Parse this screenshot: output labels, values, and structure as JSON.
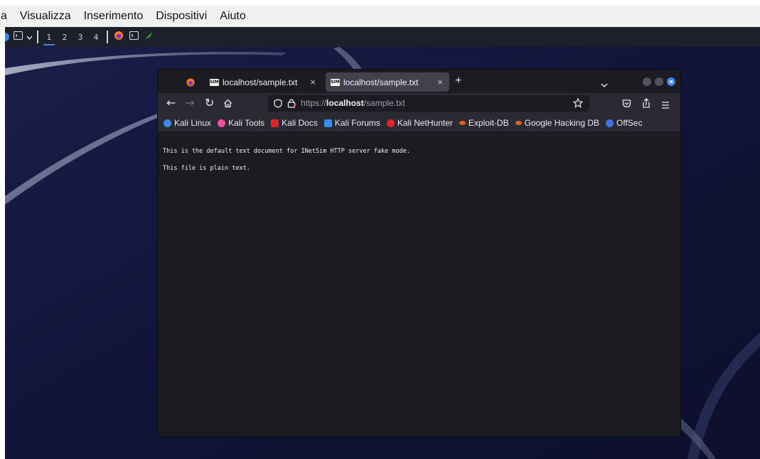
{
  "vm_menubar": {
    "items": [
      "a",
      "Visualizza",
      "Inserimento",
      "Dispositivi",
      "Aiuto"
    ]
  },
  "panel": {
    "workspaces": [
      "1",
      "2",
      "3",
      "4"
    ],
    "active_workspace": "1",
    "icons": [
      "kali-menu-icon",
      "terminal-icon",
      "chevron-down-icon",
      "firefox-icon",
      "terminal-icon",
      "kali-dragon-icon"
    ]
  },
  "browser": {
    "tabs": [
      {
        "title": "localhost/sample.txt",
        "favicon": "SIM"
      },
      {
        "title": "localhost/sample.txt",
        "favicon": "SIM"
      }
    ],
    "new_tab": "+",
    "tab_close": "×",
    "url": {
      "scheme": "https://",
      "host": "localhost",
      "path": "/sample.txt"
    },
    "toolbar_icons": [
      "back-icon",
      "forward-icon",
      "reload-icon",
      "home-icon",
      "tracking-shield-icon",
      "lock-icon",
      "bookmark-star-icon",
      "pocket-icon",
      "extensions-icon",
      "menu-icon"
    ],
    "bookmarks": [
      {
        "label": "Kali Linux",
        "color": "#3b8beb"
      },
      {
        "label": "Kali Tools",
        "color": "#ff4fa3"
      },
      {
        "label": "Kali Docs",
        "color": "#e0262d"
      },
      {
        "label": "Kali Forums",
        "color": "#3b8beb"
      },
      {
        "label": "Kali NetHunter",
        "color": "#e0262d"
      },
      {
        "label": "Exploit-DB",
        "color": "#e25f20"
      },
      {
        "label": "Google Hacking DB",
        "color": "#e25f20"
      },
      {
        "label": "OffSec",
        "color": "#3d73e8"
      }
    ],
    "content_lines": [
      "This is the default text document for INetSim HTTP server fake mode.",
      "This file is plain text."
    ]
  },
  "colors": {
    "desktop_bg": "#13163a",
    "browser_bg": "#1c1b22",
    "toolbar_bg": "#2b2a33",
    "accent": "#3b8beb"
  }
}
